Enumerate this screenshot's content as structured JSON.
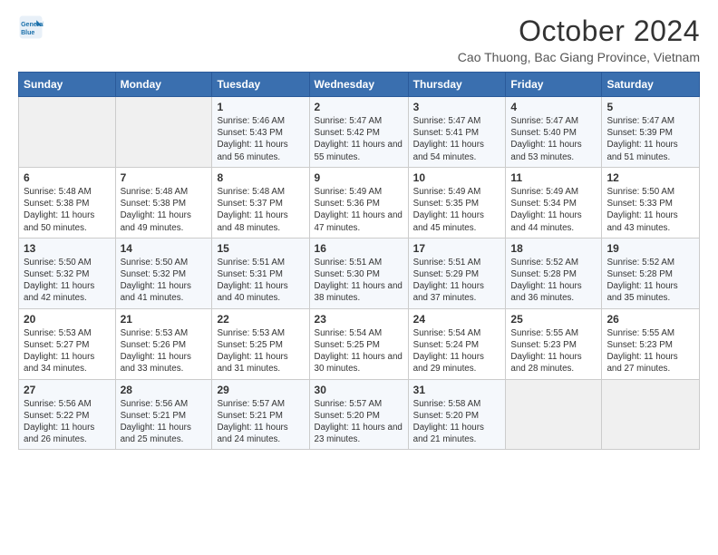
{
  "logo": {
    "line1": "General",
    "line2": "Blue"
  },
  "header": {
    "title": "October 2024",
    "subtitle": "Cao Thuong, Bac Giang Province, Vietnam"
  },
  "weekdays": [
    "Sunday",
    "Monday",
    "Tuesday",
    "Wednesday",
    "Thursday",
    "Friday",
    "Saturday"
  ],
  "weeks": [
    [
      {
        "day": "",
        "empty": true
      },
      {
        "day": "",
        "empty": true
      },
      {
        "day": "1",
        "sunrise": "5:46 AM",
        "sunset": "5:43 PM",
        "daylight": "11 hours and 56 minutes."
      },
      {
        "day": "2",
        "sunrise": "5:47 AM",
        "sunset": "5:42 PM",
        "daylight": "11 hours and 55 minutes."
      },
      {
        "day": "3",
        "sunrise": "5:47 AM",
        "sunset": "5:41 PM",
        "daylight": "11 hours and 54 minutes."
      },
      {
        "day": "4",
        "sunrise": "5:47 AM",
        "sunset": "5:40 PM",
        "daylight": "11 hours and 53 minutes."
      },
      {
        "day": "5",
        "sunrise": "5:47 AM",
        "sunset": "5:39 PM",
        "daylight": "11 hours and 51 minutes."
      }
    ],
    [
      {
        "day": "6",
        "sunrise": "5:48 AM",
        "sunset": "5:38 PM",
        "daylight": "11 hours and 50 minutes."
      },
      {
        "day": "7",
        "sunrise": "5:48 AM",
        "sunset": "5:38 PM",
        "daylight": "11 hours and 49 minutes."
      },
      {
        "day": "8",
        "sunrise": "5:48 AM",
        "sunset": "5:37 PM",
        "daylight": "11 hours and 48 minutes."
      },
      {
        "day": "9",
        "sunrise": "5:49 AM",
        "sunset": "5:36 PM",
        "daylight": "11 hours and 47 minutes."
      },
      {
        "day": "10",
        "sunrise": "5:49 AM",
        "sunset": "5:35 PM",
        "daylight": "11 hours and 45 minutes."
      },
      {
        "day": "11",
        "sunrise": "5:49 AM",
        "sunset": "5:34 PM",
        "daylight": "11 hours and 44 minutes."
      },
      {
        "day": "12",
        "sunrise": "5:50 AM",
        "sunset": "5:33 PM",
        "daylight": "11 hours and 43 minutes."
      }
    ],
    [
      {
        "day": "13",
        "sunrise": "5:50 AM",
        "sunset": "5:32 PM",
        "daylight": "11 hours and 42 minutes."
      },
      {
        "day": "14",
        "sunrise": "5:50 AM",
        "sunset": "5:32 PM",
        "daylight": "11 hours and 41 minutes."
      },
      {
        "day": "15",
        "sunrise": "5:51 AM",
        "sunset": "5:31 PM",
        "daylight": "11 hours and 40 minutes."
      },
      {
        "day": "16",
        "sunrise": "5:51 AM",
        "sunset": "5:30 PM",
        "daylight": "11 hours and 38 minutes."
      },
      {
        "day": "17",
        "sunrise": "5:51 AM",
        "sunset": "5:29 PM",
        "daylight": "11 hours and 37 minutes."
      },
      {
        "day": "18",
        "sunrise": "5:52 AM",
        "sunset": "5:28 PM",
        "daylight": "11 hours and 36 minutes."
      },
      {
        "day": "19",
        "sunrise": "5:52 AM",
        "sunset": "5:28 PM",
        "daylight": "11 hours and 35 minutes."
      }
    ],
    [
      {
        "day": "20",
        "sunrise": "5:53 AM",
        "sunset": "5:27 PM",
        "daylight": "11 hours and 34 minutes."
      },
      {
        "day": "21",
        "sunrise": "5:53 AM",
        "sunset": "5:26 PM",
        "daylight": "11 hours and 33 minutes."
      },
      {
        "day": "22",
        "sunrise": "5:53 AM",
        "sunset": "5:25 PM",
        "daylight": "11 hours and 31 minutes."
      },
      {
        "day": "23",
        "sunrise": "5:54 AM",
        "sunset": "5:25 PM",
        "daylight": "11 hours and 30 minutes."
      },
      {
        "day": "24",
        "sunrise": "5:54 AM",
        "sunset": "5:24 PM",
        "daylight": "11 hours and 29 minutes."
      },
      {
        "day": "25",
        "sunrise": "5:55 AM",
        "sunset": "5:23 PM",
        "daylight": "11 hours and 28 minutes."
      },
      {
        "day": "26",
        "sunrise": "5:55 AM",
        "sunset": "5:23 PM",
        "daylight": "11 hours and 27 minutes."
      }
    ],
    [
      {
        "day": "27",
        "sunrise": "5:56 AM",
        "sunset": "5:22 PM",
        "daylight": "11 hours and 26 minutes."
      },
      {
        "day": "28",
        "sunrise": "5:56 AM",
        "sunset": "5:21 PM",
        "daylight": "11 hours and 25 minutes."
      },
      {
        "day": "29",
        "sunrise": "5:57 AM",
        "sunset": "5:21 PM",
        "daylight": "11 hours and 24 minutes."
      },
      {
        "day": "30",
        "sunrise": "5:57 AM",
        "sunset": "5:20 PM",
        "daylight": "11 hours and 23 minutes."
      },
      {
        "day": "31",
        "sunrise": "5:58 AM",
        "sunset": "5:20 PM",
        "daylight": "11 hours and 21 minutes."
      },
      {
        "day": "",
        "empty": true
      },
      {
        "day": "",
        "empty": true
      }
    ]
  ]
}
